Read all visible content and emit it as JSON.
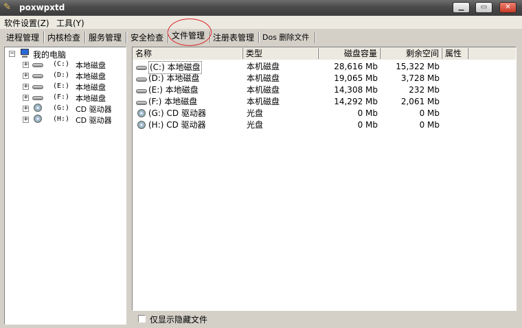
{
  "window": {
    "title": "poxwpxtd"
  },
  "menu": {
    "items": [
      "软件设置(Z)",
      "工具(Y)"
    ]
  },
  "tabs": [
    "进程管理",
    "内核检查",
    "服务管理",
    "安全检查",
    "文件管理",
    "注册表管理",
    "Dos 删除文件"
  ],
  "active_tab": "文件管理",
  "annotation_color": "#dd2222",
  "tree": {
    "root": "我的电脑",
    "drives": [
      {
        "letter": "(C:)",
        "label": "本地磁盘",
        "type": "hdd"
      },
      {
        "letter": "(D:)",
        "label": "本地磁盘",
        "type": "hdd"
      },
      {
        "letter": "(E:)",
        "label": "本地磁盘",
        "type": "hdd"
      },
      {
        "letter": "(F:)",
        "label": "本地磁盘",
        "type": "hdd"
      },
      {
        "letter": "(G:)",
        "label": "CD 驱动器",
        "type": "cd"
      },
      {
        "letter": "(H:)",
        "label": "CD 驱动器",
        "type": "cd"
      }
    ]
  },
  "list": {
    "columns": [
      "名称",
      "类型",
      "磁盘容量",
      "剩余空间",
      "属性"
    ],
    "rows": [
      {
        "name": "(C:) 本地磁盘",
        "type": "本机磁盘",
        "capacity": "28,616 Mb",
        "free": "15,322 Mb",
        "icon": "hdd"
      },
      {
        "name": "(D:) 本地磁盘",
        "type": "本机磁盘",
        "capacity": "19,065 Mb",
        "free": "3,728 Mb",
        "icon": "hdd"
      },
      {
        "name": "(E:) 本地磁盘",
        "type": "本机磁盘",
        "capacity": "14,308 Mb",
        "free": "232 Mb",
        "icon": "hdd"
      },
      {
        "name": "(F:) 本地磁盘",
        "type": "本机磁盘",
        "capacity": "14,292 Mb",
        "free": "2,061 Mb",
        "icon": "hdd"
      },
      {
        "name": "(G:) CD 驱动器",
        "type": "光盘",
        "capacity": "0 Mb",
        "free": "0 Mb",
        "icon": "cd"
      },
      {
        "name": "(H:) CD 驱动器",
        "type": "光盘",
        "capacity": "0 Mb",
        "free": "0 Mb",
        "icon": "cd"
      }
    ]
  },
  "options": {
    "show_hidden_label": "仅显示隐藏文件"
  }
}
